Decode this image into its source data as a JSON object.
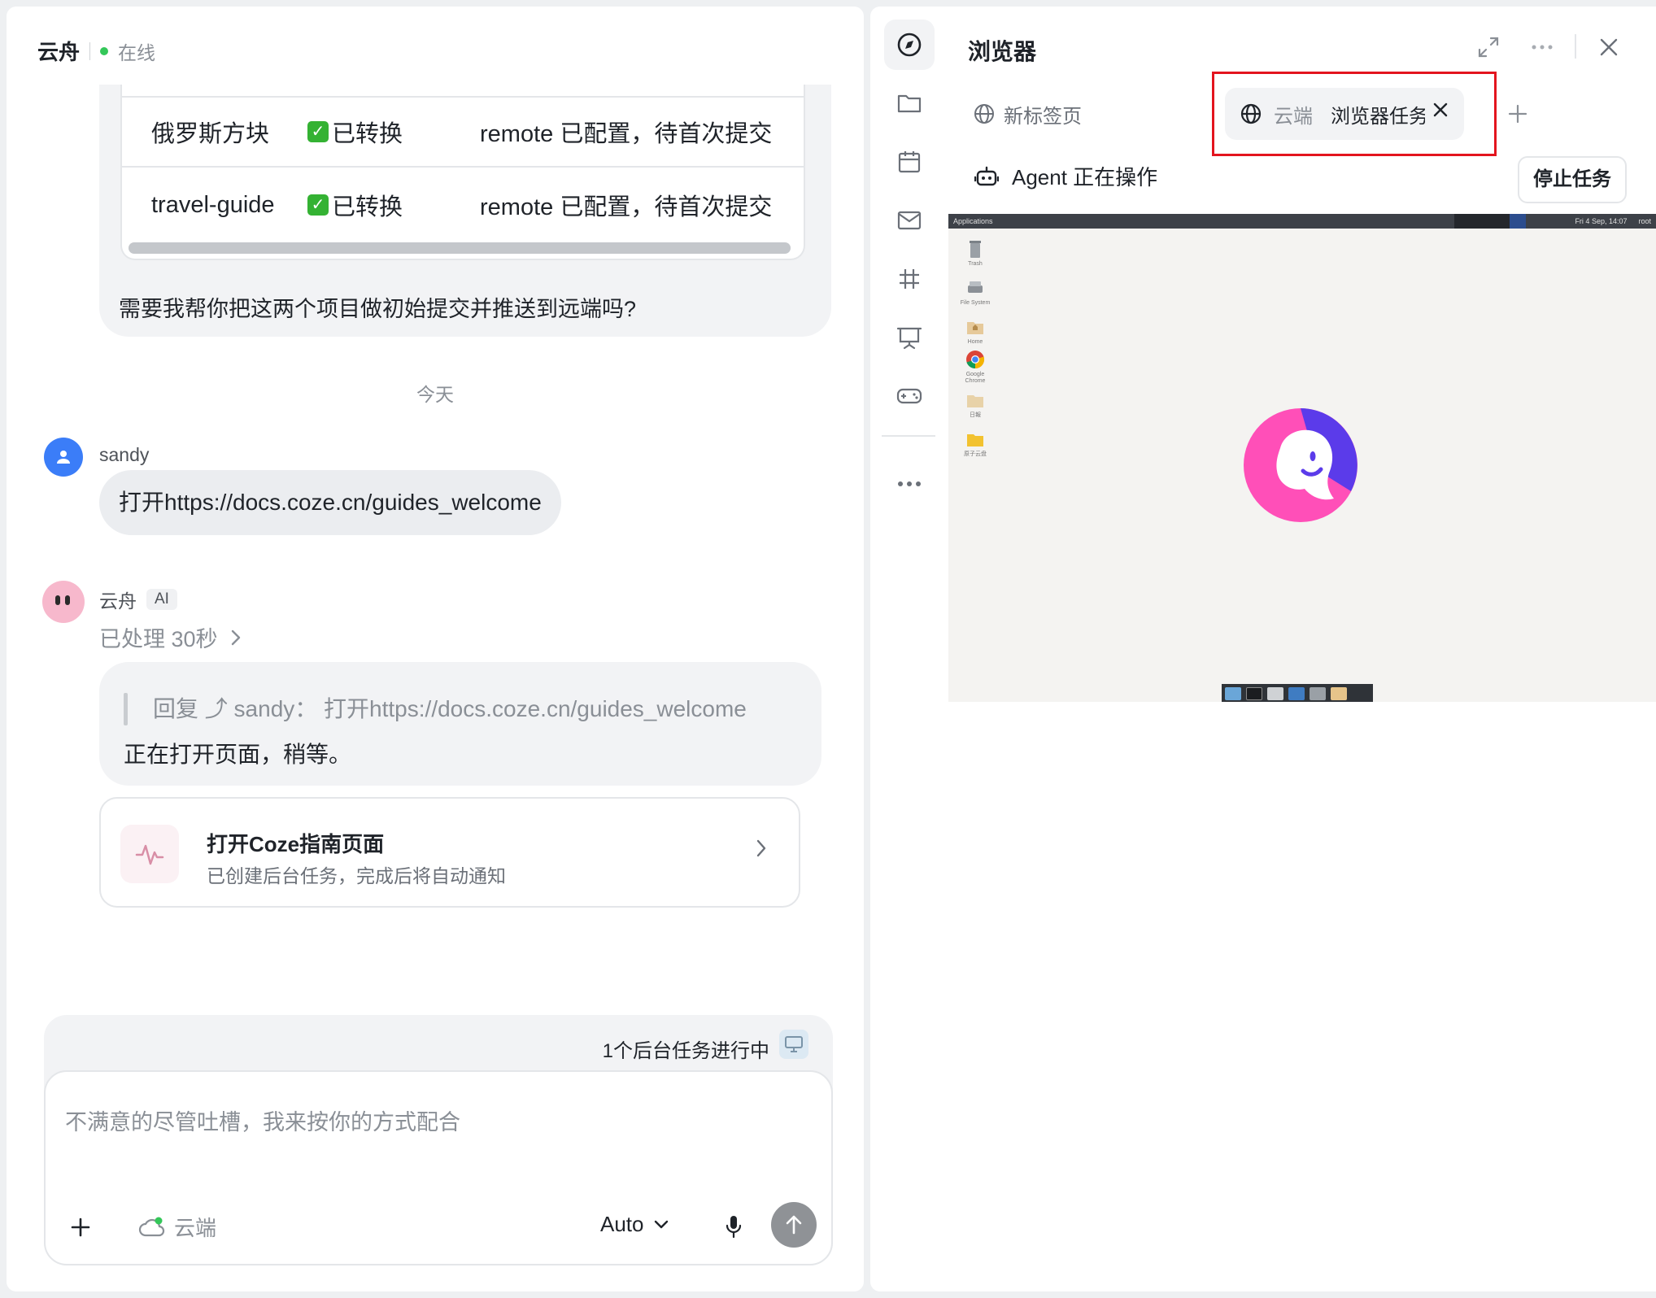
{
  "chat": {
    "title": "云舟",
    "status": "在线",
    "prev_table": {
      "rows": [
        {
          "name": "俄罗斯方块",
          "state": "已转换",
          "note": "remote 已配置，待首次提交"
        },
        {
          "name": "travel-guide",
          "state": "已转换",
          "note": "remote 已配置，待首次提交"
        }
      ]
    },
    "prev_question": "需要我帮你把这两个项目做初始提交并推送到远端吗?",
    "date_divider": "今天",
    "user_message": {
      "name": "sandy",
      "text": "打开https://docs.coze.cn/guides_welcome"
    },
    "ai_message": {
      "name": "云舟",
      "badge": "AI",
      "processed": "已处理 30秒",
      "quote": "回复 ⤴ sandy： 打开https://docs.coze.cn/guides_welcome",
      "text": "正在打开页面，稍等。",
      "task_card": {
        "title": "打开Coze指南页面",
        "subtitle": "已创建后台任务，完成后将自动通知"
      }
    },
    "composer": {
      "bg_tasks": "1个后台任务进行中",
      "placeholder": "不满意的尽管吐槽，我来按你的方式配合",
      "cloud_label": "云端",
      "mode": "Auto"
    }
  },
  "browser": {
    "title": "浏览器",
    "tabs": [
      {
        "label": "新标签页",
        "prefix": "",
        "active": false
      },
      {
        "label": "浏览器任务",
        "prefix": "云端",
        "active": true
      }
    ],
    "agent_status": "Agent 正在操作",
    "stop_button": "停止任务",
    "vm": {
      "menu": "Applications",
      "clock": "Fri 4 Sep, 14:07",
      "user": "root",
      "desktop_icons": [
        "Trash",
        "File System",
        "Home",
        "Google Chrome",
        "日報",
        "原子云盘"
      ]
    }
  },
  "colors": {
    "accent_blue": "#3b7df8",
    "online_green": "#34c759",
    "highlight_red": "#e3141e",
    "logo_purple": "#5b3bea",
    "logo_pink": "#ff4fb8"
  },
  "icons": [
    "compass-icon",
    "folder-icon",
    "calendar-icon",
    "mail-icon",
    "hash-icon",
    "presentation-icon",
    "gamepad-icon",
    "more-icon",
    "expand-icon",
    "close-icon",
    "globe-icon",
    "plus-icon",
    "robot-icon",
    "mic-icon",
    "send-icon",
    "monitor-icon",
    "cloud-icon",
    "chevron-down-icon",
    "chevron-right-icon",
    "pulse-icon",
    "user-icon"
  ]
}
